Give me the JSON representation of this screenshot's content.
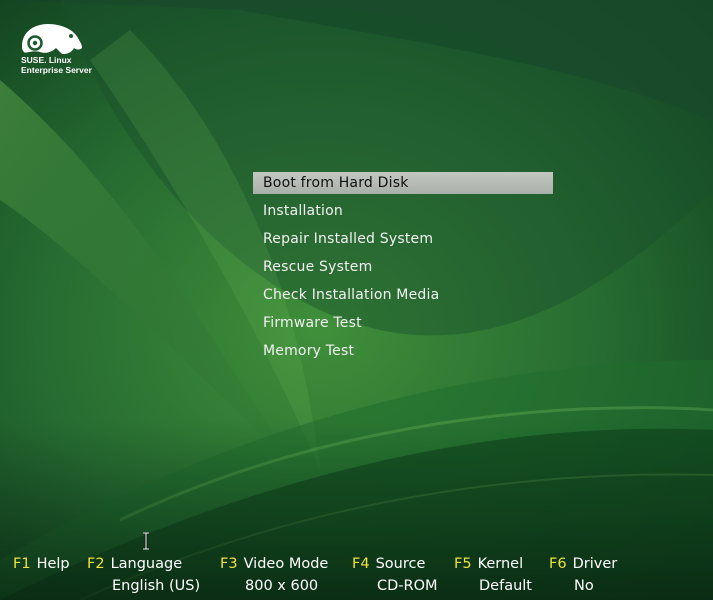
{
  "brand": {
    "line1": "SUSE. Linux",
    "line2": "Enterprise Server"
  },
  "menu": {
    "items": [
      {
        "label": "Boot from Hard Disk",
        "selected": true
      },
      {
        "label": "Installation",
        "selected": false
      },
      {
        "label": "Repair Installed System",
        "selected": false
      },
      {
        "label": "Rescue System",
        "selected": false
      },
      {
        "label": "Check Installation Media",
        "selected": false
      },
      {
        "label": "Firmware Test",
        "selected": false
      },
      {
        "label": "Memory Test",
        "selected": false
      }
    ]
  },
  "function_keys": [
    {
      "key": "F1",
      "label": "Help",
      "value": ""
    },
    {
      "key": "F2",
      "label": "Language",
      "value": "English (US)"
    },
    {
      "key": "F3",
      "label": "Video Mode",
      "value": "800 x 600"
    },
    {
      "key": "F4",
      "label": "Source",
      "value": "CD-ROM"
    },
    {
      "key": "F5",
      "label": "Kernel",
      "value": "Default"
    },
    {
      "key": "F6",
      "label": "Driver",
      "value": "No"
    }
  ],
  "colors": {
    "background_dark": "#0f3d1c",
    "background_light": "#4a9a3a",
    "fkey_accent": "#f0e23a",
    "selection": "#b8bdb8"
  },
  "icons": {
    "logo": "chameleon-logo-icon",
    "pointer": "text-cursor-icon"
  }
}
